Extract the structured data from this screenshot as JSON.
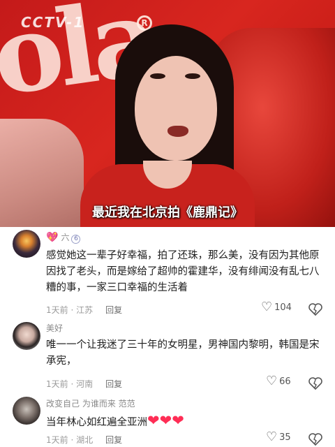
{
  "video": {
    "watermark": "CCTV-1",
    "subtitle": "最近我在北京拍《鹿鼎记》",
    "logo_text": "ola",
    "logo_mark": "R"
  },
  "comments": [
    {
      "username": "六",
      "level": "6",
      "text": "感觉她这一辈子好幸福，拍了还珠，那么美，没有因为其他原因找了老头，而是嫁给了超帅的霍建华，没有绯闻没有乱七八糟的事，一家三口幸福的生活着",
      "time_location": "1天前 · 江苏",
      "reply_label": "回复",
      "likes": "104"
    },
    {
      "username": "美好",
      "text": "唯一一个让我迷了三十年的女明星，男神国内黎明，韩国是宋承宪，",
      "time_location": "1天前 · 河南",
      "reply_label": "回复",
      "likes": "66"
    },
    {
      "username": "改变自己 为谁而来 范范",
      "text": "当年林心如红遍全亚洲",
      "emojis": "❤❤❤",
      "time_location": "1天前 · 湖北",
      "reply_label": "回复",
      "likes": "35"
    }
  ],
  "colors": {
    "accent_red": "#c8221d",
    "text": "#1d1d1d",
    "meta": "#9a9a9a"
  },
  "icons": [
    "heart-outline-icon",
    "broken-heart-icon",
    "sparkle-heart-icon",
    "level-badge-icon"
  ]
}
